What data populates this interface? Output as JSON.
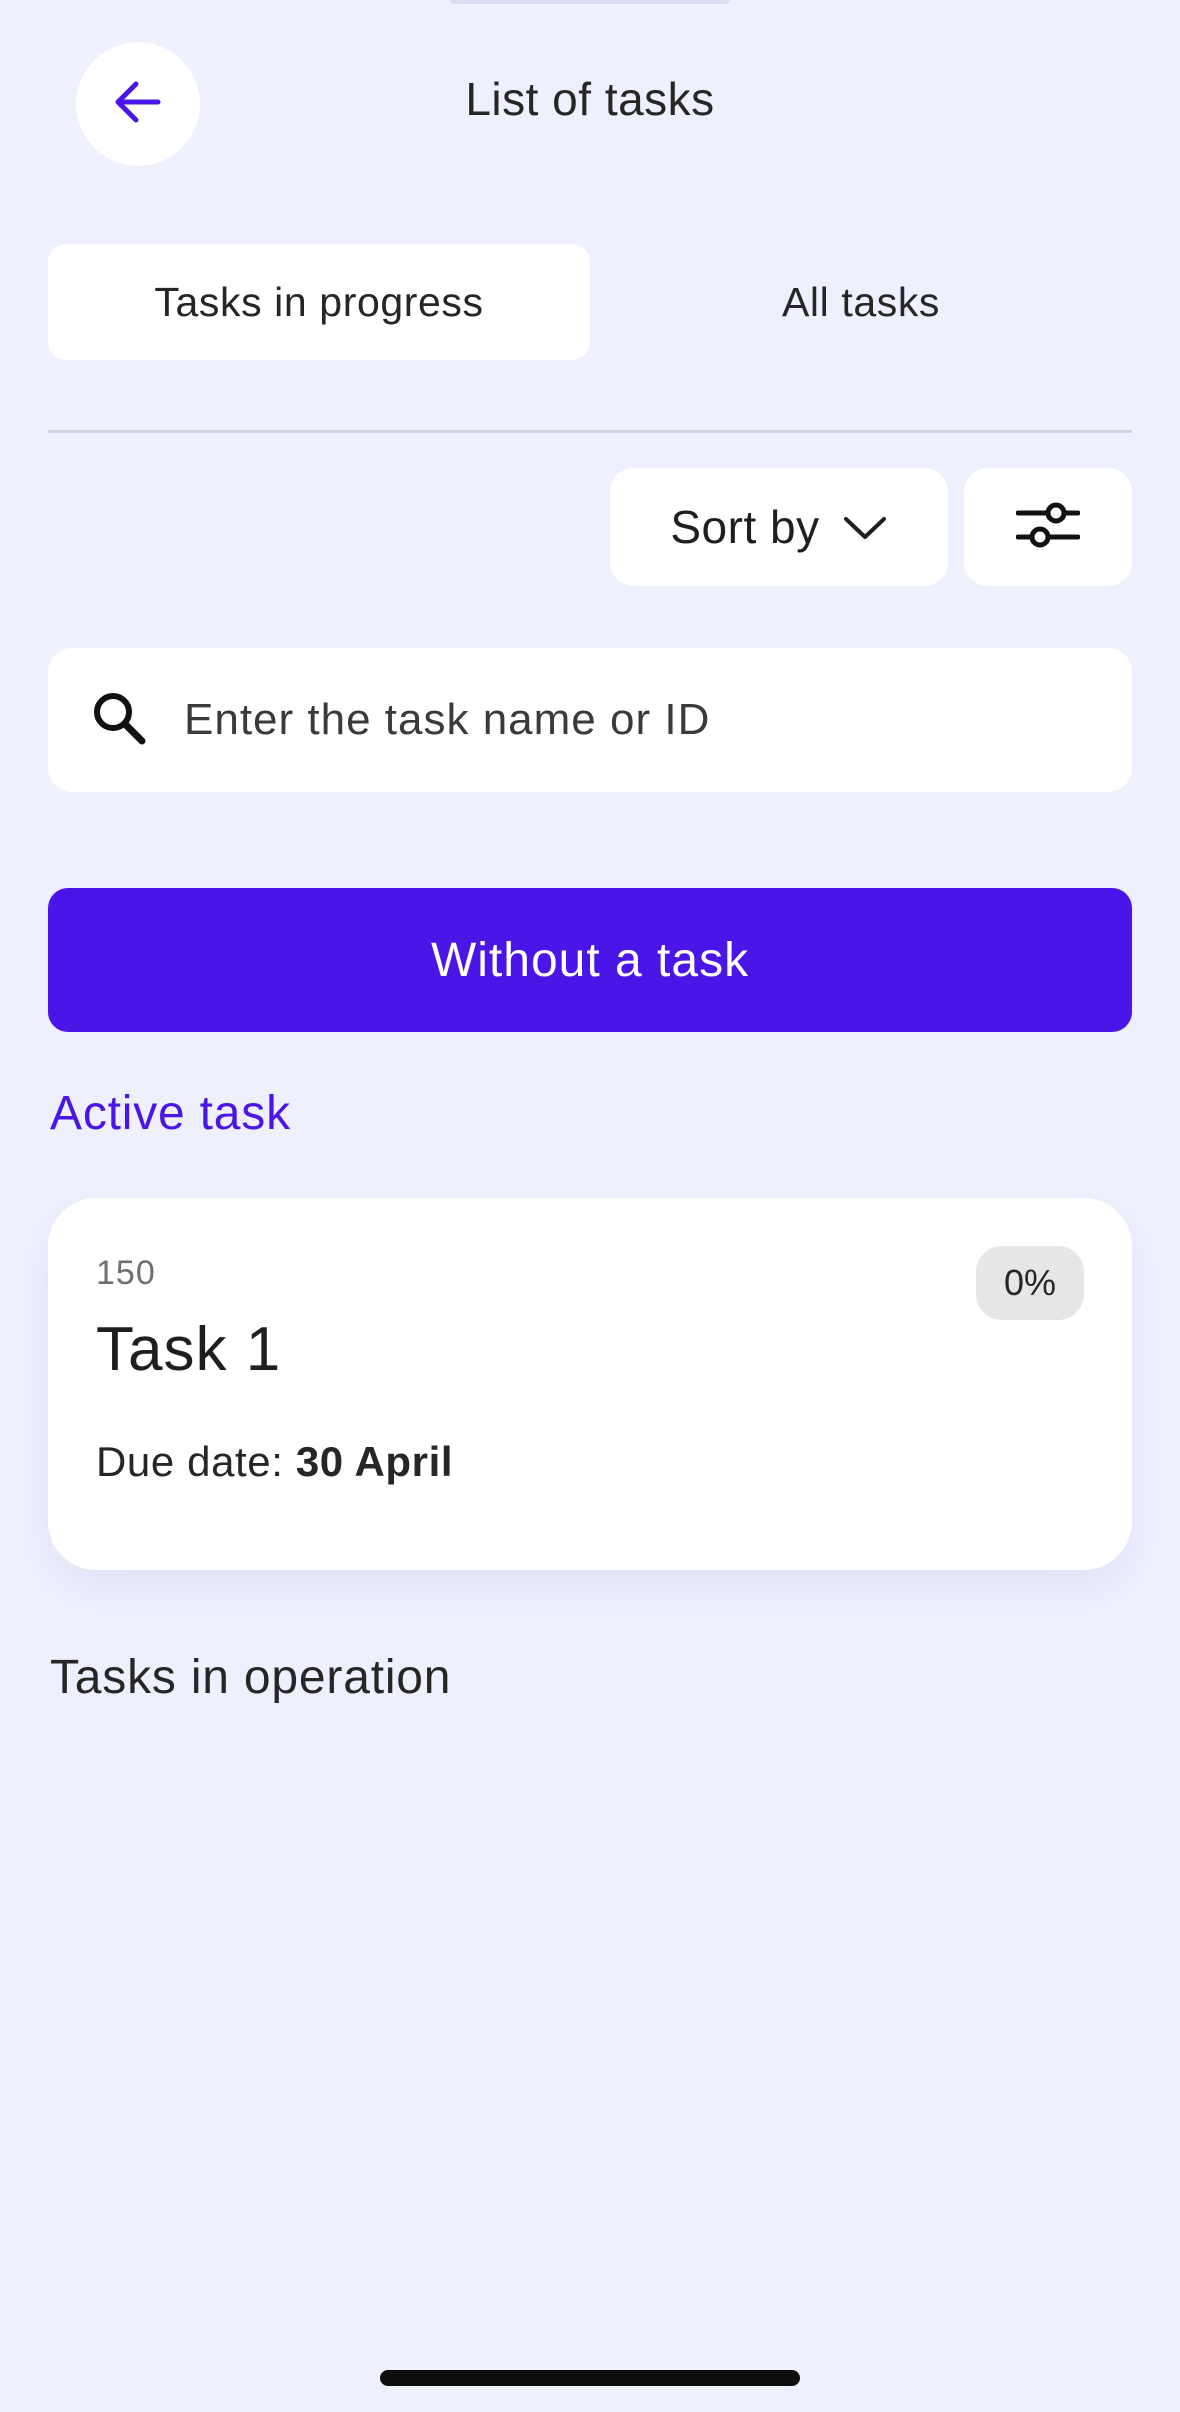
{
  "header": {
    "title": "List of tasks",
    "back_icon": "arrow-left-icon"
  },
  "tabs": [
    {
      "label": "Tasks in progress",
      "active": true
    },
    {
      "label": "All tasks",
      "active": false
    }
  ],
  "toolbar": {
    "sort_label": "Sort by",
    "sort_icon": "chevron-down-icon",
    "filter_icon": "sliders-icon"
  },
  "search": {
    "placeholder": "Enter the task name or ID",
    "value": "",
    "icon": "search-icon"
  },
  "primary_button": {
    "label": "Without a task"
  },
  "active_section": {
    "title": "Active task",
    "task": {
      "id": "150",
      "name": "Task 1",
      "progress": "0%",
      "due_label": "Due date:",
      "due_value": "30 April"
    }
  },
  "operation_section": {
    "title": "Tasks in operation"
  },
  "colors": {
    "background": "#eff0fd",
    "accent": "#4a16e8",
    "surface": "#ffffff"
  }
}
